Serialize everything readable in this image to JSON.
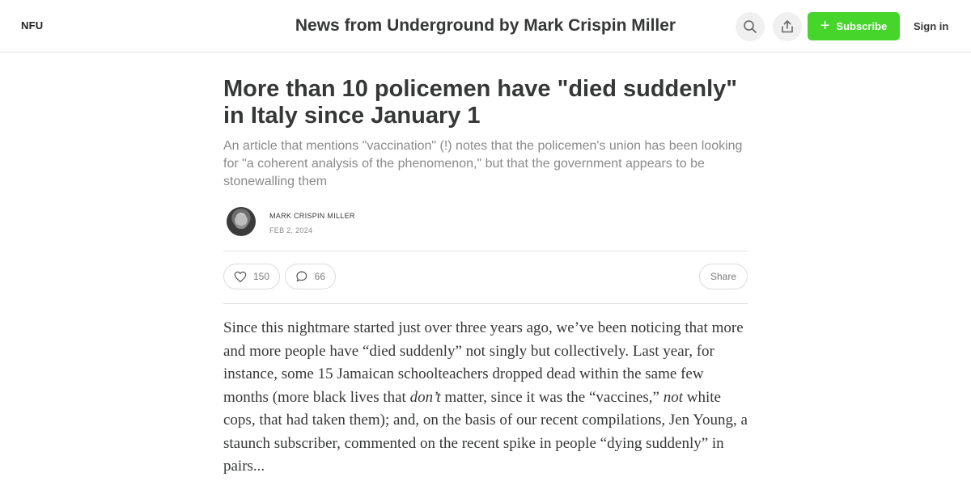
{
  "header": {
    "logo": "NFU",
    "publication_title": "News from Underground by Mark Crispin Miller",
    "subscribe_label": "Subscribe",
    "signin_label": "Sign in"
  },
  "article": {
    "title": "More than 10 policemen have \"died suddenly\" in Italy since January 1",
    "subtitle": "An article that mentions \"vaccination\" (!) notes that the policemen's union has been looking for \"a coherent analysis of the phenomenon,\" but that the government appears to be stonewalling them",
    "author": "MARK CRISPIN MILLER",
    "date": "FEB 2, 2024",
    "likes": "150",
    "comments": "66",
    "share_label": "Share",
    "body": {
      "p1": "Since this nightmare started just over three years ago, we’ve been noticing that more and more people have “died suddenly” not singly but collectively. Last year, for instance, some 15 Jamaican schoolteachers dropped dead within the same few months (more black lives that ",
      "em1": "don’t",
      "p2": " matter, since it was the “vaccines,” ",
      "em2": "not",
      "p3": " white cops, that had taken them); and, on the basis of our recent compilations, Jen Young, a staunch subscriber, commented on the recent spike in people “dying suddenly” in pairs..."
    }
  }
}
